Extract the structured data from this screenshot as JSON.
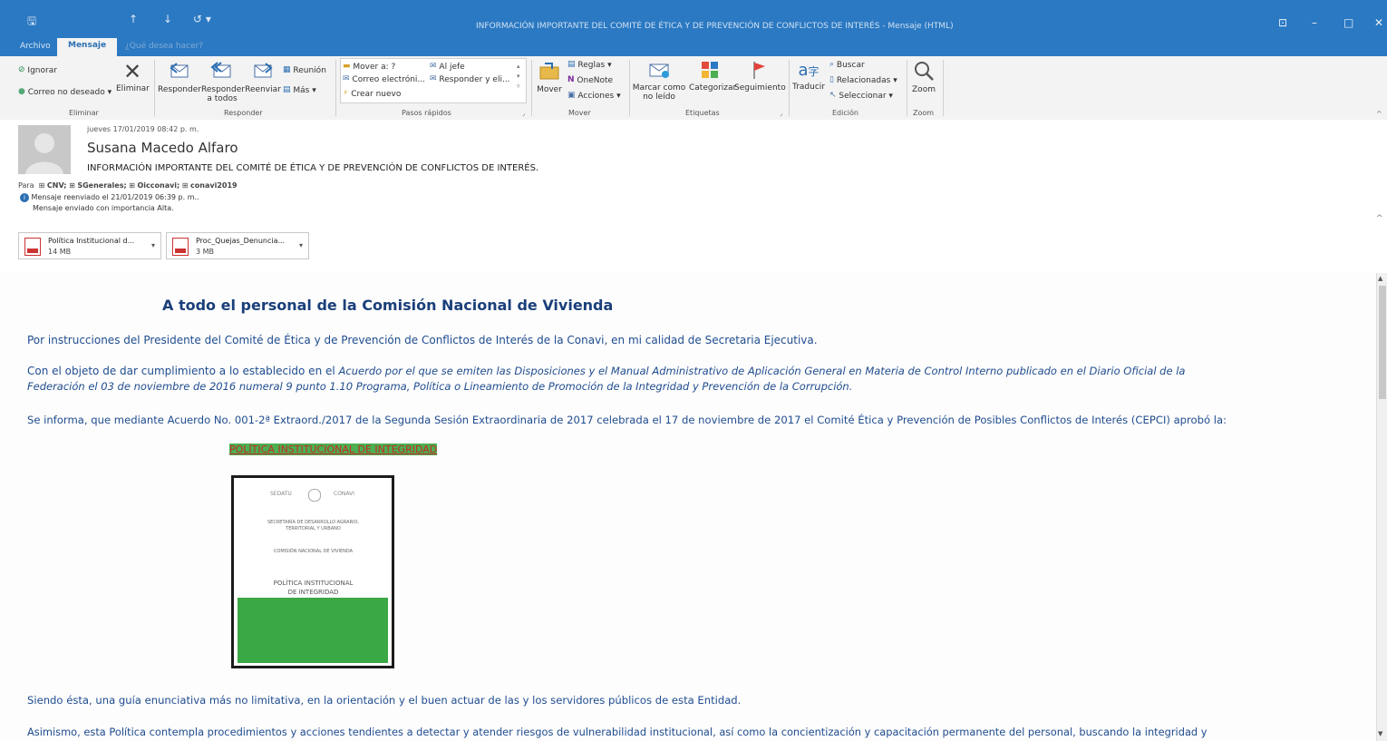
{
  "window": {
    "title": "INFORMACIÓN IMPORTANTE DEL COMITÉ DE ÉTICA Y DE PREVENCIÓN DE CONFLICTOS DE INTERÉS - Mensaje (HTML)",
    "tabs": [
      "Archivo",
      "Mensaje",
      "¿Qué desea hacer?"
    ],
    "controls": [
      "?",
      "⊡",
      "–",
      "□",
      "✕"
    ]
  },
  "ribbon": {
    "delete_group": {
      "ignore": "Ignorar",
      "junk": "Correo no deseado",
      "delete": "Eliminar",
      "label": "Eliminar"
    },
    "respond_group": {
      "reply": "Responder",
      "reply_all": "Responder a todos",
      "forward": "Reenviar",
      "meeting": "Reunión",
      "more": "Más",
      "label": "Responder"
    },
    "quick_steps": {
      "items": [
        "Mover a: ?",
        "Al jefe",
        "Correo electróni...",
        "Responder y eli...",
        "Crear nuevo"
      ],
      "label": "Pasos rápidos"
    },
    "move_group": {
      "move": "Mover",
      "rules": "Reglas",
      "onenote": "OneNote",
      "actions": "Acciones",
      "label": "Mover"
    },
    "tags_group": {
      "mark_unread": "Marcar como no leído",
      "categorize": "Categorizar",
      "follow_up": "Seguimiento",
      "label": "Etiquetas"
    },
    "edit_group": {
      "translate": "Traducir",
      "find": "Buscar",
      "related": "Relacionadas",
      "select": "Seleccionar",
      "label": "Edición"
    },
    "zoom_group": {
      "zoom": "Zoom",
      "label": "Zoom"
    }
  },
  "header": {
    "date": "jueves 17/01/2019 08:42 p. m.",
    "sender": "Susana Macedo Alfaro",
    "subject": "INFORMACIÓN IMPORTANTE DEL COMITÉ DE ÉTICA Y DE PREVENCIÓN DE CONFLICTOS DE INTERÉS.",
    "to_label": "Para",
    "recipients": [
      "CNV;",
      "SGenerales;",
      "Oicconavi;",
      "conavi2019"
    ],
    "info1": "Mensaje reenviado el 21/01/2019 06:39 p. m..",
    "info2": "Mensaje enviado con importancia Alta."
  },
  "attachments": [
    {
      "name": "Política Institucional d...",
      "size": "14 MB"
    },
    {
      "name": "Proc_Quejas_Denuncia...",
      "size": "3 MB"
    }
  ],
  "body": {
    "heading": "A todo el personal de la Comisión Nacional de Vivienda",
    "p1": "Por instrucciones del Presidente del Comité de Ética y de Prevención de Conflictos de Interés de la Conavi, en mi calidad de Secretaria Ejecutiva.",
    "p2_plain": "Con el objeto de dar cumplimiento a lo establecido en el ",
    "p2_italic": "Acuerdo por el que se emiten las Disposiciones y el Manual Administrativo de Aplicación General en Materia de Control Interno publicado en el Diario Oficial de la",
    "p2_italic2": "Federación el 03 de noviembre de 2016 numeral 9 punto 1.10 Programa, Política o Lineamiento de Promoción de la Integridad y Prevención de la Corrupción.",
    "p3": "Se informa, que mediante Acuerdo No. 001-2ª Extraord./2017 de la Segunda Sesión Extraordinaria de 2017 celebrada el 17 de noviembre de 2017 el Comité Ética y Prevención de Posibles Conflictos de Interés (CEPCI) aprobó la:",
    "link": "POLÍTICA INSTITUCIONAL DE INTEGRIDAD",
    "cover": {
      "logo_left": "SEDATU",
      "logo_right": "CONAVI",
      "secretaria": "SECRETARÍA DE DESARROLLO AGRARIO, TERRITORIAL Y URBANO",
      "comision": "COMISIÓN NACIONAL DE VIVIENDA",
      "title1": "POLÍTICA INSTITUCIONAL",
      "title2": "DE INTEGRIDAD"
    },
    "p4": "Siendo ésta, una guía enunciativa más no limitativa, en la orientación y el buen actuar de las y los servidores públicos de esta Entidad.",
    "p5": "Asimismo, esta Política contempla procedimientos y acciones tendientes a detectar y atender riesgos de vulnerabilidad institucional, así como la concientización y capacitación permanente del personal, buscando la integridad y"
  },
  "colors": {
    "titlebar": "#2b79c2",
    "body_text": "#1f4c8f",
    "link_bg": "#4caf50",
    "cover_green": "#3aa845"
  }
}
